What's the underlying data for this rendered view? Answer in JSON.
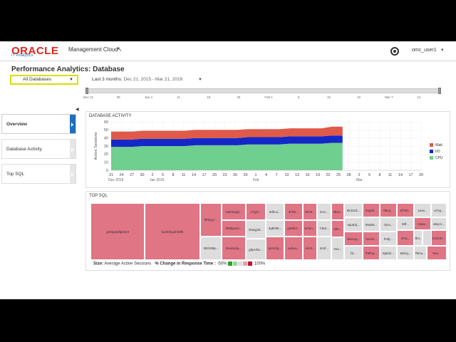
{
  "header": {
    "brand": "ORACLE",
    "product": "Management Cloud",
    "subproduct": "IT Analytics",
    "user": "omc_user1"
  },
  "page": {
    "title": "Performance Analytics: Database",
    "db_filter": "All Databases",
    "range_label": "Last 3 months",
    "range_dates": "Dec 21, 2015 - Mar 21, 2016"
  },
  "timeline": {
    "ticks": [
      "Dec 21",
      "28",
      "Jan 4",
      "11",
      "18",
      "25",
      "Feb 1",
      "8",
      "15",
      "22",
      "Mar 7",
      "14"
    ]
  },
  "nav": {
    "items": [
      {
        "label": "Overview",
        "active": true
      },
      {
        "label": "Database Activity",
        "active": false
      },
      {
        "label": "Top SQL",
        "active": false
      }
    ]
  },
  "activity": {
    "title": "DATABASE ACTIVITY",
    "month_labels": [
      "Dec 2015",
      "Jan 2016",
      "Feb",
      "Mar"
    ]
  },
  "chart_data": {
    "type": "area",
    "title": "DATABASE ACTIVITY",
    "ylabel": "Active Sessions",
    "xlabel": "",
    "ylim": [
      0,
      60
    ],
    "yticks": [
      0,
      10,
      20,
      30,
      40,
      50,
      60
    ],
    "x_tick_labels": [
      "21",
      "24",
      "27",
      "30",
      "2",
      "5",
      "8",
      "11",
      "14",
      "17",
      "20",
      "23",
      "26",
      "29",
      "1",
      "4",
      "7",
      "10",
      "13",
      "16",
      "19",
      "22",
      "25",
      "28",
      "2",
      "5",
      "8",
      "11",
      "14",
      "17",
      "20"
    ],
    "data_end_index": 22.4,
    "series": [
      {
        "name": "CPU",
        "color": "#6fcf8e",
        "values": [
          29,
          29,
          29,
          30,
          30,
          30,
          30,
          30,
          31,
          31,
          31,
          31,
          31,
          32,
          32,
          32,
          32,
          33,
          33,
          33,
          33,
          34,
          34
        ]
      },
      {
        "name": "I/O",
        "color": "#1428c8",
        "values": [
          9,
          9,
          9,
          9,
          9,
          9,
          9,
          9,
          9,
          9,
          9,
          9,
          9,
          9,
          9,
          9,
          9,
          9,
          9,
          9,
          9,
          9,
          9
        ]
      },
      {
        "name": "Wait",
        "color": "#e05a4a",
        "values": [
          10,
          10,
          10,
          10,
          10,
          10,
          10,
          10,
          10,
          10,
          10,
          10,
          10,
          10,
          10,
          10,
          10,
          10,
          10,
          10,
          10,
          11,
          11
        ]
      }
    ],
    "legend": [
      "Wait",
      "I/O",
      "CPU"
    ],
    "legend_position": "right"
  },
  "topsql": {
    "title": "TOP SQL",
    "legend_size_label": "Size:",
    "legend_size_value": "Average Active Sessions",
    "legend_change_label": "% Change in Response Time :",
    "legend_min": "-50%",
    "legend_max": "100%",
    "legend_colors": [
      "#2ca02c",
      "#98d398",
      "#dddddd",
      "#e8a0a8",
      "#c8102e"
    ],
    "cells": [
      {
        "id": "gmbpy6dfgs8c3",
        "color": "#e07585"
      },
      {
        "id": "bqmbfyq4n9dfn",
        "color": "#e07585"
      },
      {
        "id": "f0hkyyc...",
        "color": "#e07585"
      },
      {
        "id": "bnjfn5q2p...",
        "color": "#e07585"
      },
      {
        "id": "17g2f...",
        "color": "#e07585"
      },
      {
        "id": "9dhn1...",
        "color": "#dddddd"
      },
      {
        "id": "dcfzk...",
        "color": "#e07585"
      },
      {
        "id": "8hr3l...",
        "color": "#e07585"
      },
      {
        "id": "2crc...",
        "color": "#dddddd"
      },
      {
        "id": "d9s6...",
        "color": "#e07585"
      },
      {
        "id": "3b9bpsss...",
        "color": "#e07585"
      },
      {
        "id": "8swyjsb...",
        "color": "#dddddd"
      },
      {
        "id": "3qkh9b...",
        "color": "#dddddd"
      },
      {
        "id": "g05bt2...",
        "color": "#e07585"
      },
      {
        "id": "6m0n...",
        "color": "#e07585"
      },
      {
        "id": "7362...",
        "color": "#dddddd"
      },
      {
        "id": "aftn...",
        "color": "#e07585"
      },
      {
        "id": "381h09p...",
        "color": "#dddddd"
      },
      {
        "id": "0mazp4p...",
        "color": "#e07585"
      },
      {
        "id": "g8pcrbc...",
        "color": "#dddddd"
      },
      {
        "id": "gsh43q...",
        "color": "#e07585"
      },
      {
        "id": "aykvw...",
        "color": "#e07585"
      },
      {
        "id": "44c8...",
        "color": "#e07585"
      },
      {
        "id": "dcsf...",
        "color": "#dddddd"
      },
      {
        "id": "01v...",
        "color": "#dddddd"
      },
      {
        "id": "6k43cd...",
        "color": "#dddddd"
      },
      {
        "id": "d4g8h...",
        "color": "#e07585"
      },
      {
        "id": "85cq...",
        "color": "#e07585"
      },
      {
        "id": "6f78d...",
        "color": "#e07585"
      },
      {
        "id": "1ass...",
        "color": "#dddddd"
      },
      {
        "id": "a7xg...",
        "color": "#dddddd"
      },
      {
        "id": "aqu53j...",
        "color": "#dddddd"
      },
      {
        "id": "85a55...",
        "color": "#dddddd"
      },
      {
        "id": "7pcv...",
        "color": "#dddddd"
      },
      {
        "id": "59f...",
        "color": "#dddddd"
      },
      {
        "id": "c5aw...",
        "color": "#e07585"
      },
      {
        "id": "a9qc1...",
        "color": "#dddddd"
      },
      {
        "id": "dsxvxq...",
        "color": "#e07585"
      },
      {
        "id": "0xcs0...",
        "color": "#e07585"
      },
      {
        "id": "hn9j...",
        "color": "#dddddd"
      },
      {
        "id": "3mq...",
        "color": "#e07585"
      },
      {
        "id": "4b4...",
        "color": "#dddddd"
      },
      {
        "id": "bf...",
        "color": "#dddddd"
      },
      {
        "id": "fd...",
        "color": "#dddddd"
      },
      {
        "id": "fh8fup...",
        "color": "#e07585"
      },
      {
        "id": "6pkxb...",
        "color": "#dddddd"
      },
      {
        "id": "66Gq...",
        "color": "#dddddd"
      },
      {
        "id": "f9mu...",
        "color": "#dddddd"
      },
      {
        "id": "9ua...",
        "color": "#e07585"
      },
      {
        "id": "024c8z...",
        "color": "#e07585"
      }
    ]
  }
}
